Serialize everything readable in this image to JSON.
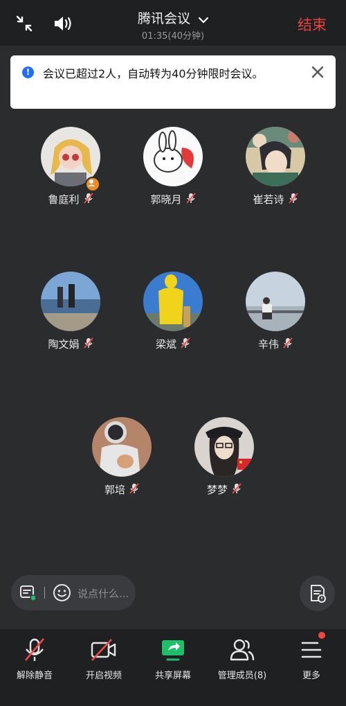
{
  "header": {
    "title": "腾讯会议",
    "subtitle": "01:35(40分钟)",
    "end_label": "结束",
    "icons": [
      "collapse-icon",
      "speaker-icon",
      "chevron-down-icon"
    ]
  },
  "notice": {
    "text": "会议已超过2人，自动转为40分钟限时会议。",
    "icons": [
      "info-icon",
      "close-icon"
    ]
  },
  "participants": [
    {
      "name": "鲁庭利",
      "muted": true,
      "host": true
    },
    {
      "name": "郭晓月",
      "muted": true,
      "host": false
    },
    {
      "name": "崔若诗",
      "muted": true,
      "host": false
    },
    {
      "name": "陶文娟",
      "muted": true,
      "host": false
    },
    {
      "name": "梁斌",
      "muted": true,
      "host": false
    },
    {
      "name": "辛伟",
      "muted": true,
      "host": false
    },
    {
      "name": "郭培",
      "muted": true,
      "host": false
    },
    {
      "name": "梦梦",
      "muted": true,
      "host": false
    }
  ],
  "chat": {
    "placeholder": "说点什么..."
  },
  "toolbar": {
    "unmute_label": "解除静音",
    "video_label": "开启视频",
    "share_label": "共享屏幕",
    "members_label": "管理成员(8)",
    "more_label": "更多"
  },
  "colors": {
    "accent_red": "#e9423f",
    "share_green": "#1fbf6a",
    "info_blue": "#1e6ff5",
    "host_orange": "#f08a24"
  }
}
